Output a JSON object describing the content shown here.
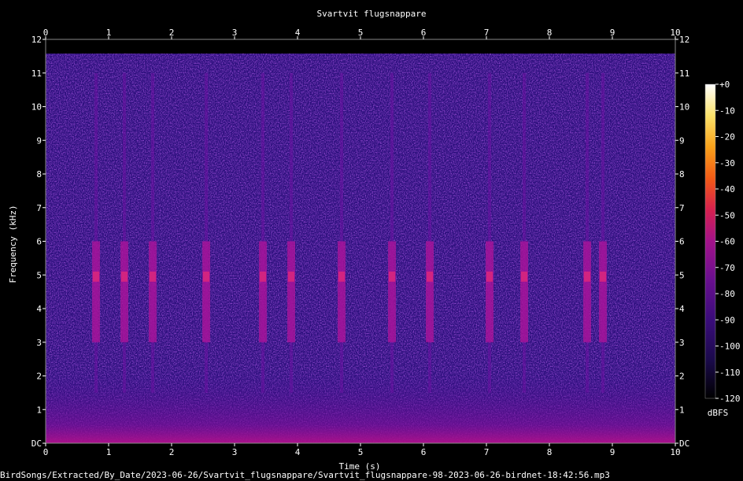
{
  "chart_data": {
    "type": "heatmap",
    "title": "Svartvit flugsnappare",
    "xlabel": "Time (s)",
    "ylabel": "Frequency (kHz)",
    "xlim": [
      0,
      10
    ],
    "ylim": [
      0,
      12
    ],
    "x_ticks": [
      "0",
      "1",
      "2",
      "3",
      "4",
      "5",
      "6",
      "7",
      "8",
      "9",
      "10"
    ],
    "y_ticks": [
      "DC",
      "1",
      "2",
      "3",
      "4",
      "5",
      "6",
      "7",
      "8",
      "9",
      "10",
      "11",
      "12"
    ],
    "colorbar": {
      "label": "dBFS",
      "range": [
        -120,
        0
      ],
      "ticks": [
        "+0",
        "-10",
        "-20",
        "-30",
        "-40",
        "-50",
        "-60",
        "-70",
        "-80",
        "-90",
        "-100",
        "-110",
        "-120"
      ],
      "colors": [
        "#000000",
        "#1a0a4a",
        "#3a0c7a",
        "#6a0f8f",
        "#a3128a",
        "#d6204f",
        "#f25a16",
        "#f9a11a",
        "#fbe26a",
        "#ffffff"
      ]
    },
    "background_level_db": -95,
    "signal_events_s": [
      0.8,
      1.25,
      1.7,
      2.55,
      3.45,
      3.9,
      4.7,
      5.5,
      6.1,
      7.05,
      7.6,
      8.6,
      8.85
    ],
    "song_band_khz": [
      3,
      6
    ]
  },
  "footer": {
    "file_path": "BirdSongs/Extracted/By_Date/2023-06-26/Svartvit_flugsnappare/Svartvit_flugsnappare-98-2023-06-26-birdnet-18:42:56.mp3"
  }
}
